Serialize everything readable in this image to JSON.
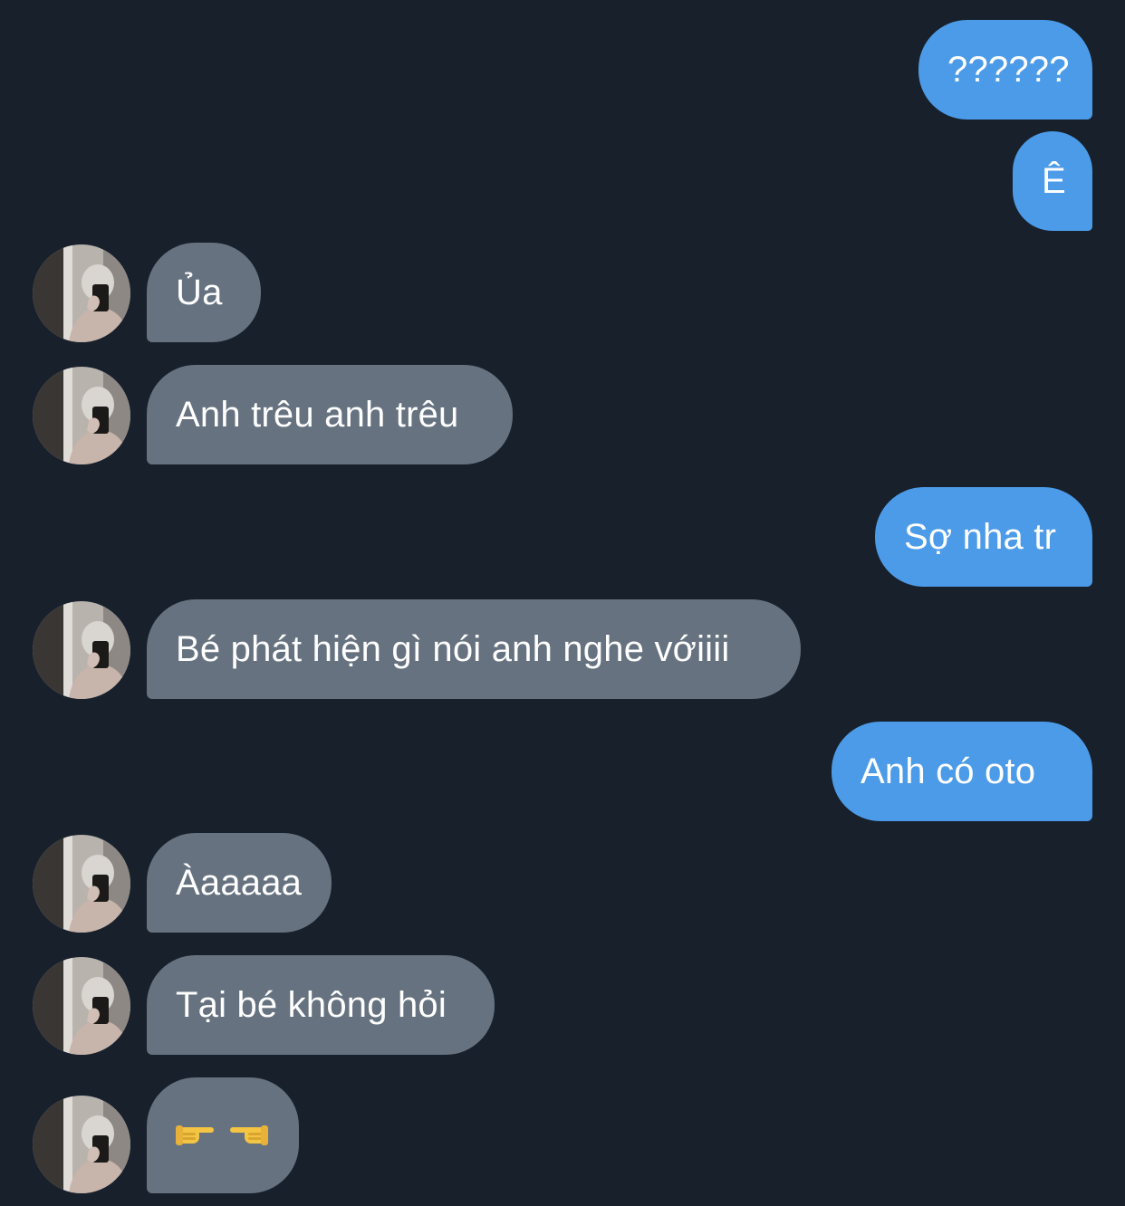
{
  "colors": {
    "background": "#17202b",
    "sent_bubble": "#4c9be8",
    "received_bubble": "#66727f",
    "text": "#ffffff"
  },
  "messages": [
    {
      "sender": "me",
      "text": "??????"
    },
    {
      "sender": "me",
      "text": "Ê"
    },
    {
      "sender": "them",
      "text": "Ủa",
      "avatar": "profile-photo"
    },
    {
      "sender": "them",
      "text": "Anh trêu anh trêu",
      "avatar": "profile-photo"
    },
    {
      "sender": "me",
      "text": "Sợ nha tr"
    },
    {
      "sender": "them",
      "text": "Bé phát hiện gì nói anh nghe vớiiii",
      "avatar": "profile-photo"
    },
    {
      "sender": "me",
      "text": "Anh có oto"
    },
    {
      "sender": "them",
      "text": "Àaaaaa",
      "avatar": "profile-photo"
    },
    {
      "sender": "them",
      "text": "Tại bé không hỏi",
      "avatar": "profile-photo"
    },
    {
      "sender": "them",
      "text": "👉👈",
      "icons": [
        "pointing-right-icon",
        "pointing-left-icon"
      ],
      "avatar": "profile-photo"
    }
  ]
}
